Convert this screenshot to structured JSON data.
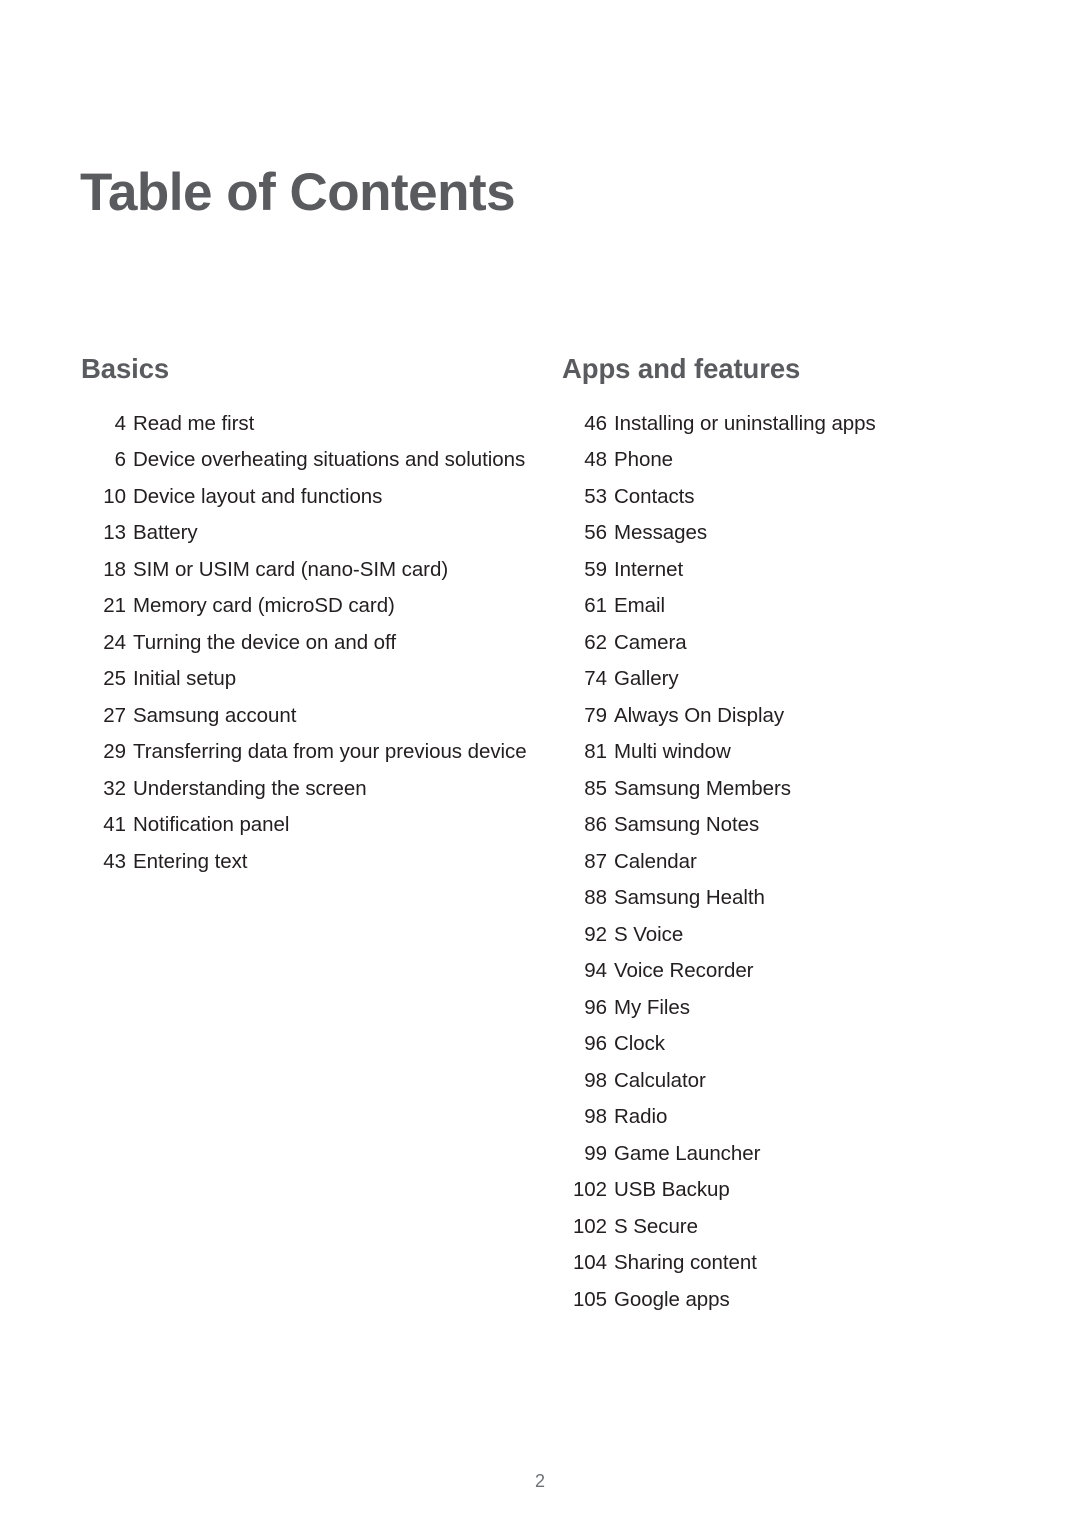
{
  "document": {
    "title": "Table of Contents",
    "footer_page_number": "2",
    "colors": {
      "heading": "#5a5b5f",
      "body_text": "#231f20",
      "footer": "#6e7074",
      "background": "#ffffff"
    }
  },
  "columns": {
    "left": {
      "heading": "Basics",
      "entries": [
        {
          "page": "4",
          "title": "Read me first"
        },
        {
          "page": "6",
          "title": "Device overheating situations and solutions"
        },
        {
          "page": "10",
          "title": "Device layout and functions"
        },
        {
          "page": "13",
          "title": "Battery"
        },
        {
          "page": "18",
          "title": "SIM or USIM card (nano-SIM card)"
        },
        {
          "page": "21",
          "title": "Memory card (microSD card)"
        },
        {
          "page": "24",
          "title": "Turning the device on and off"
        },
        {
          "page": "25",
          "title": "Initial setup"
        },
        {
          "page": "27",
          "title": "Samsung account"
        },
        {
          "page": "29",
          "title": "Transferring data from your previous device"
        },
        {
          "page": "32",
          "title": "Understanding the screen"
        },
        {
          "page": "41",
          "title": "Notification panel"
        },
        {
          "page": "43",
          "title": "Entering text"
        }
      ]
    },
    "right": {
      "heading": "Apps and features",
      "entries": [
        {
          "page": "46",
          "title": "Installing or uninstalling apps"
        },
        {
          "page": "48",
          "title": "Phone"
        },
        {
          "page": "53",
          "title": "Contacts"
        },
        {
          "page": "56",
          "title": "Messages"
        },
        {
          "page": "59",
          "title": "Internet"
        },
        {
          "page": "61",
          "title": "Email"
        },
        {
          "page": "62",
          "title": "Camera"
        },
        {
          "page": "74",
          "title": "Gallery"
        },
        {
          "page": "79",
          "title": "Always On Display"
        },
        {
          "page": "81",
          "title": "Multi window"
        },
        {
          "page": "85",
          "title": "Samsung Members"
        },
        {
          "page": "86",
          "title": "Samsung Notes"
        },
        {
          "page": "87",
          "title": "Calendar"
        },
        {
          "page": "88",
          "title": "Samsung Health"
        },
        {
          "page": "92",
          "title": "S Voice"
        },
        {
          "page": "94",
          "title": "Voice Recorder"
        },
        {
          "page": "96",
          "title": "My Files"
        },
        {
          "page": "96",
          "title": "Clock"
        },
        {
          "page": "98",
          "title": "Calculator"
        },
        {
          "page": "98",
          "title": "Radio"
        },
        {
          "page": "99",
          "title": "Game Launcher"
        },
        {
          "page": "102",
          "title": "USB Backup"
        },
        {
          "page": "102",
          "title": "S Secure"
        },
        {
          "page": "104",
          "title": "Sharing content"
        },
        {
          "page": "105",
          "title": "Google apps"
        }
      ]
    }
  }
}
